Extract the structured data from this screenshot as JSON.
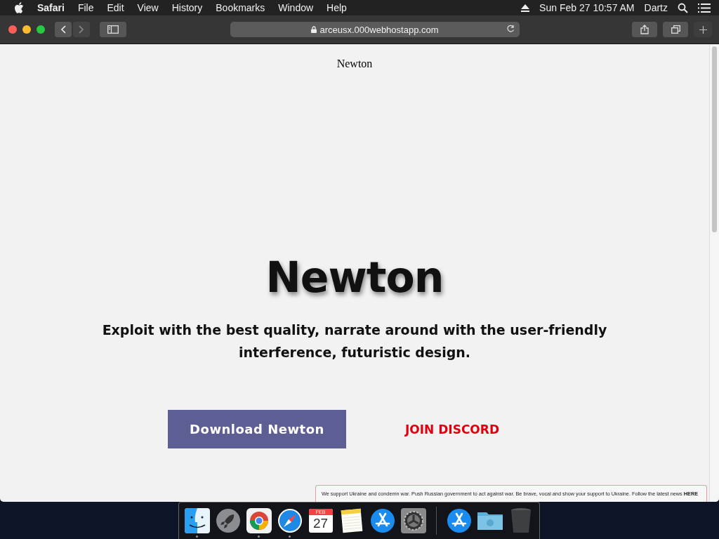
{
  "menubar": {
    "app": "Safari",
    "menus": [
      "File",
      "Edit",
      "View",
      "History",
      "Bookmarks",
      "Window",
      "Help"
    ],
    "clock": "Sun Feb 27  10:57 AM",
    "user": "Dartz"
  },
  "browser": {
    "address": "arceusx.000webhostapp.com",
    "back_disabled": false,
    "forward_disabled": true
  },
  "page": {
    "header": "Newton",
    "hero_title": "Newton",
    "tagline": "Exploit with the best quality, narrate around with the user-friendly interference, futuristic design.",
    "primary_button": "Download Newton",
    "secondary_link": "JOIN DISCORD",
    "banner": "We support Ukraine and condemn war. Push Russian government to act against war. Be brave, vocal and show your support to Ukraine. Follow the latest news **HERE**"
  },
  "dock": [
    {
      "kind": "finder",
      "running": true
    },
    {
      "kind": "rocket",
      "running": false
    },
    {
      "kind": "chrome",
      "running": true
    },
    {
      "kind": "safari",
      "running": true
    },
    {
      "kind": "calendar",
      "running": false,
      "month": "FEB",
      "day": "27"
    },
    {
      "kind": "notes",
      "running": false
    },
    {
      "kind": "appstore",
      "running": false
    },
    {
      "kind": "settings",
      "running": false
    },
    {
      "kind": "separator"
    },
    {
      "kind": "appstore",
      "running": false
    },
    {
      "kind": "folder",
      "running": false
    },
    {
      "kind": "trash",
      "running": false
    }
  ]
}
